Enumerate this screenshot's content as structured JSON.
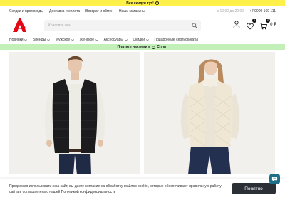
{
  "promo_top": {
    "text": "Все скидки тут!",
    "icon": "arrow-right-circle-icon"
  },
  "util_left": [
    "Скидки и промокоды",
    "Доставка и оплата",
    "Возврат и обмен",
    "Наши магазины"
  ],
  "util_right": {
    "hours": "с 10:00 до 20:00",
    "phone": "+7 9000 169 111"
  },
  "header": {
    "logo": "logo-a",
    "search_placeholder": "Красовки жен",
    "favorites_count": "0",
    "cart_count": "0",
    "cart_total": "0 ₽"
  },
  "nav": [
    {
      "label": "Новинки",
      "has_menu": true
    },
    {
      "label": "Бренды",
      "has_menu": true
    },
    {
      "label": "Мужское",
      "has_menu": true
    },
    {
      "label": "Женское",
      "has_menu": true
    },
    {
      "label": "Аксессуары",
      "has_menu": true
    },
    {
      "label": "Скидки",
      "has_menu": true
    },
    {
      "label": "Подарочные сертификаты",
      "has_menu": false
    }
  ],
  "promo_green": {
    "text": "Платите частями в",
    "brand": "Сплит"
  },
  "cookie": {
    "text": "Продолжая использовать наш сайт, вы даете согласие на обработку файлов cookie, которые обеспечивают правильную работу сайта и соглашаетесь с нашей",
    "link": "Политикой конфиденциальности",
    "button": "Понятно"
  },
  "colors": {
    "accent": "#e30613",
    "promo_yellow": "#fff14a",
    "promo_green": "#c2f0b8",
    "button_dark": "#2b2f36",
    "chat": "#1d6f88"
  }
}
